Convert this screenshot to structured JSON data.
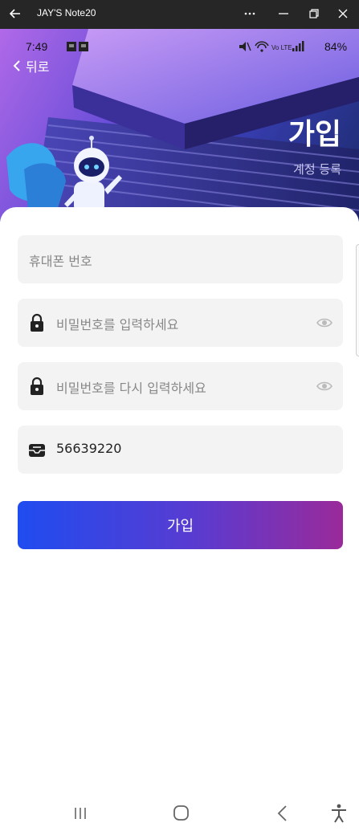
{
  "window": {
    "title": "JAY'S Note20"
  },
  "status": {
    "time": "7:49",
    "battery": "84%"
  },
  "header": {
    "back_label": "뒤로",
    "title": "가입",
    "subtitle": "계정 등록"
  },
  "form": {
    "phone_placeholder": "휴대폰 번호",
    "password_placeholder": "비밀번호를 입력하세요",
    "confirm_placeholder": "비밀번호를 다시 입력하세요",
    "invite_code": "56639220",
    "submit_label": "가입"
  },
  "colors": {
    "button_gradient_start": "#1f4cf0",
    "button_gradient_end": "#9a2a9a",
    "field_background": "#f3f3f3"
  },
  "icons": [
    "back-arrow-icon",
    "more-icon",
    "minimize-icon",
    "restore-icon",
    "close-icon",
    "lock-icon",
    "eye-icon",
    "inbox-icon",
    "recents-icon",
    "home-icon",
    "nav-back-icon",
    "accessibility-icon"
  ]
}
